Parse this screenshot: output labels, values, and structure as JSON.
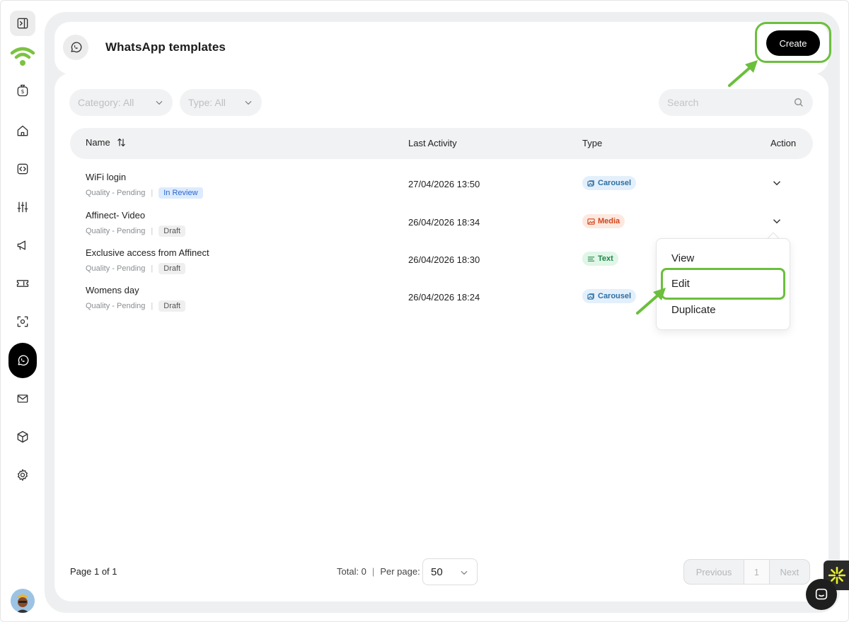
{
  "sidebar": {
    "items": [
      {
        "name": "sidebar-toggle",
        "icon": "panel-toggle-icon"
      },
      {
        "name": "brand-logo",
        "icon": "wifi-logo-icon"
      },
      {
        "name": "billing",
        "icon": "money-bag-icon"
      },
      {
        "name": "home",
        "icon": "home-icon"
      },
      {
        "name": "code",
        "icon": "code-icon"
      },
      {
        "name": "settings-sliders",
        "icon": "sliders-icon"
      },
      {
        "name": "campaigns",
        "icon": "megaphone-icon"
      },
      {
        "name": "tickets",
        "icon": "ticket-icon"
      },
      {
        "name": "scan",
        "icon": "scan-icon"
      },
      {
        "name": "whatsapp",
        "icon": "whatsapp-icon",
        "active": true
      },
      {
        "name": "email",
        "icon": "mail-icon"
      },
      {
        "name": "products",
        "icon": "cube-icon"
      },
      {
        "name": "settings",
        "icon": "gear-icon"
      }
    ]
  },
  "header": {
    "title": "WhatsApp templates",
    "create_label": "Create"
  },
  "filters": {
    "category": "Category: All",
    "type": "Type: All",
    "search_placeholder": "Search"
  },
  "table": {
    "columns": {
      "name": "Name",
      "last_activity": "Last Activity",
      "type": "Type",
      "action": "Action"
    },
    "rows": [
      {
        "name": "WiFi login",
        "quality": "Quality - Pending",
        "status": "In Review",
        "date": "27/04/2026 13:50",
        "type": "Carousel"
      },
      {
        "name": "Affinect- Video",
        "quality": "Quality - Pending",
        "status": "Draft",
        "date": "26/04/2026 18:34",
        "type": "Media"
      },
      {
        "name": "Exclusive access from Affinect",
        "quality": "Quality - Pending",
        "status": "Draft",
        "date": "26/04/2026 18:30",
        "type": "Text"
      },
      {
        "name": "Womens day",
        "quality": "Quality - Pending",
        "status": "Draft",
        "date": "26/04/2026 18:24",
        "type": "Carousel"
      }
    ]
  },
  "action_menu": {
    "items": [
      "View",
      "Edit",
      "Duplicate"
    ]
  },
  "footer": {
    "page_info": "Page 1 of 1",
    "total": "Total: 0",
    "per_page_label": "Per page:",
    "per_page_value": "50",
    "previous": "Previous",
    "page_number": "1",
    "next": "Next"
  },
  "colors": {
    "accent_highlight": "#6bbf3c",
    "brand_green": "#7cc242",
    "primary_button": "#000000"
  }
}
